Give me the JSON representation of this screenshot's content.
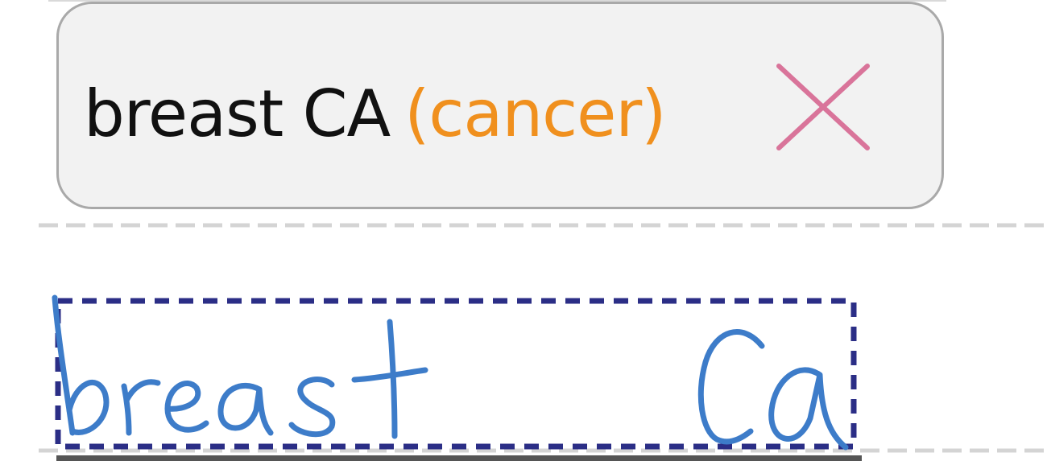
{
  "suggestion": {
    "term": "breast CA",
    "expansion": "(cancer)",
    "term_color": "#111111",
    "expansion_color": "#f0901e",
    "dismiss_icon": "close-icon",
    "dismiss_color": "#d9749a"
  },
  "handwriting": {
    "ink_color": "#3d7cc9",
    "selection_color": "#2b2e86",
    "words": [
      "breast",
      "CA"
    ]
  }
}
